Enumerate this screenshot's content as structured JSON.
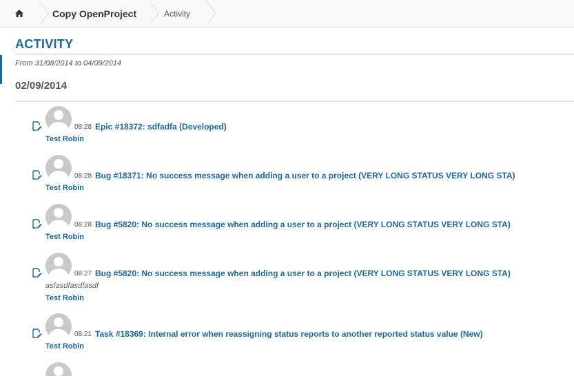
{
  "breadcrumb": {
    "home_icon": "home-icon",
    "project": "Copy OpenProject",
    "current": "Activity"
  },
  "header": {
    "title": "ACTIVITY",
    "date_range": "From 31/08/2014 to 04/09/2014"
  },
  "day": {
    "date": "02/09/2014"
  },
  "entries": [
    {
      "icon": "edit-icon",
      "time": "08:28",
      "title": "Epic #18372: sdfadfa (Developed)",
      "comment": "",
      "author": "Test Robin"
    },
    {
      "icon": "edit-icon",
      "time": "08:28",
      "title": "Bug #18371: No success message when adding a user to a project (VERY LONG STATUS VERY LONG STA)",
      "comment": "",
      "author": "Test Robin"
    },
    {
      "icon": "edit-icon",
      "time": "08:28",
      "title": "Bug #5820: No success message when adding a user to a project (VERY LONG STATUS VERY LONG STA)",
      "comment": "",
      "author": "Test Robin"
    },
    {
      "icon": "edit-icon",
      "time": "08:27",
      "title": "Bug #5820: No success message when adding a user to a project (VERY LONG STATUS VERY LONG STA)",
      "comment": "asfasdfasdfasdf",
      "author": "Test Robin"
    },
    {
      "icon": "edit-icon",
      "time": "08:21",
      "title": "Task #18369: Internal error when reassigning status reports to another reported status value (New)",
      "comment": "",
      "author": "Test Robin"
    }
  ],
  "colors": {
    "link": "#1a67a3",
    "muted": "#555555",
    "breadcrumb_bg": "#f8f8f8"
  }
}
